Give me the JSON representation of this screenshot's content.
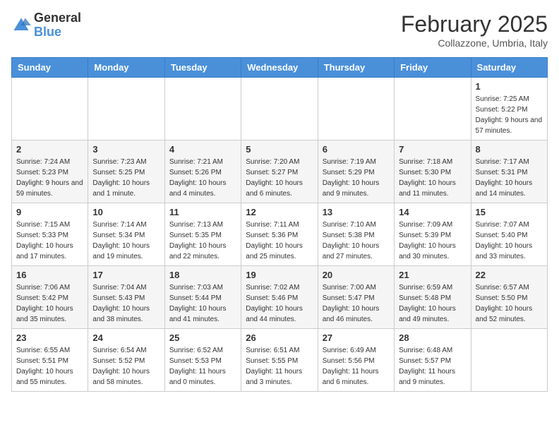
{
  "header": {
    "logo_line1": "General",
    "logo_line2": "Blue",
    "month_title": "February 2025",
    "location": "Collazzone, Umbria, Italy"
  },
  "days_of_week": [
    "Sunday",
    "Monday",
    "Tuesday",
    "Wednesday",
    "Thursday",
    "Friday",
    "Saturday"
  ],
  "weeks": [
    [
      {
        "day": "",
        "info": ""
      },
      {
        "day": "",
        "info": ""
      },
      {
        "day": "",
        "info": ""
      },
      {
        "day": "",
        "info": ""
      },
      {
        "day": "",
        "info": ""
      },
      {
        "day": "",
        "info": ""
      },
      {
        "day": "1",
        "info": "Sunrise: 7:25 AM\nSunset: 5:22 PM\nDaylight: 9 hours and 57 minutes."
      }
    ],
    [
      {
        "day": "2",
        "info": "Sunrise: 7:24 AM\nSunset: 5:23 PM\nDaylight: 9 hours and 59 minutes."
      },
      {
        "day": "3",
        "info": "Sunrise: 7:23 AM\nSunset: 5:25 PM\nDaylight: 10 hours and 1 minute."
      },
      {
        "day": "4",
        "info": "Sunrise: 7:21 AM\nSunset: 5:26 PM\nDaylight: 10 hours and 4 minutes."
      },
      {
        "day": "5",
        "info": "Sunrise: 7:20 AM\nSunset: 5:27 PM\nDaylight: 10 hours and 6 minutes."
      },
      {
        "day": "6",
        "info": "Sunrise: 7:19 AM\nSunset: 5:29 PM\nDaylight: 10 hours and 9 minutes."
      },
      {
        "day": "7",
        "info": "Sunrise: 7:18 AM\nSunset: 5:30 PM\nDaylight: 10 hours and 11 minutes."
      },
      {
        "day": "8",
        "info": "Sunrise: 7:17 AM\nSunset: 5:31 PM\nDaylight: 10 hours and 14 minutes."
      }
    ],
    [
      {
        "day": "9",
        "info": "Sunrise: 7:15 AM\nSunset: 5:33 PM\nDaylight: 10 hours and 17 minutes."
      },
      {
        "day": "10",
        "info": "Sunrise: 7:14 AM\nSunset: 5:34 PM\nDaylight: 10 hours and 19 minutes."
      },
      {
        "day": "11",
        "info": "Sunrise: 7:13 AM\nSunset: 5:35 PM\nDaylight: 10 hours and 22 minutes."
      },
      {
        "day": "12",
        "info": "Sunrise: 7:11 AM\nSunset: 5:36 PM\nDaylight: 10 hours and 25 minutes."
      },
      {
        "day": "13",
        "info": "Sunrise: 7:10 AM\nSunset: 5:38 PM\nDaylight: 10 hours and 27 minutes."
      },
      {
        "day": "14",
        "info": "Sunrise: 7:09 AM\nSunset: 5:39 PM\nDaylight: 10 hours and 30 minutes."
      },
      {
        "day": "15",
        "info": "Sunrise: 7:07 AM\nSunset: 5:40 PM\nDaylight: 10 hours and 33 minutes."
      }
    ],
    [
      {
        "day": "16",
        "info": "Sunrise: 7:06 AM\nSunset: 5:42 PM\nDaylight: 10 hours and 35 minutes."
      },
      {
        "day": "17",
        "info": "Sunrise: 7:04 AM\nSunset: 5:43 PM\nDaylight: 10 hours and 38 minutes."
      },
      {
        "day": "18",
        "info": "Sunrise: 7:03 AM\nSunset: 5:44 PM\nDaylight: 10 hours and 41 minutes."
      },
      {
        "day": "19",
        "info": "Sunrise: 7:02 AM\nSunset: 5:46 PM\nDaylight: 10 hours and 44 minutes."
      },
      {
        "day": "20",
        "info": "Sunrise: 7:00 AM\nSunset: 5:47 PM\nDaylight: 10 hours and 46 minutes."
      },
      {
        "day": "21",
        "info": "Sunrise: 6:59 AM\nSunset: 5:48 PM\nDaylight: 10 hours and 49 minutes."
      },
      {
        "day": "22",
        "info": "Sunrise: 6:57 AM\nSunset: 5:50 PM\nDaylight: 10 hours and 52 minutes."
      }
    ],
    [
      {
        "day": "23",
        "info": "Sunrise: 6:55 AM\nSunset: 5:51 PM\nDaylight: 10 hours and 55 minutes."
      },
      {
        "day": "24",
        "info": "Sunrise: 6:54 AM\nSunset: 5:52 PM\nDaylight: 10 hours and 58 minutes."
      },
      {
        "day": "25",
        "info": "Sunrise: 6:52 AM\nSunset: 5:53 PM\nDaylight: 11 hours and 0 minutes."
      },
      {
        "day": "26",
        "info": "Sunrise: 6:51 AM\nSunset: 5:55 PM\nDaylight: 11 hours and 3 minutes."
      },
      {
        "day": "27",
        "info": "Sunrise: 6:49 AM\nSunset: 5:56 PM\nDaylight: 11 hours and 6 minutes."
      },
      {
        "day": "28",
        "info": "Sunrise: 6:48 AM\nSunset: 5:57 PM\nDaylight: 11 hours and 9 minutes."
      },
      {
        "day": "",
        "info": ""
      }
    ]
  ]
}
